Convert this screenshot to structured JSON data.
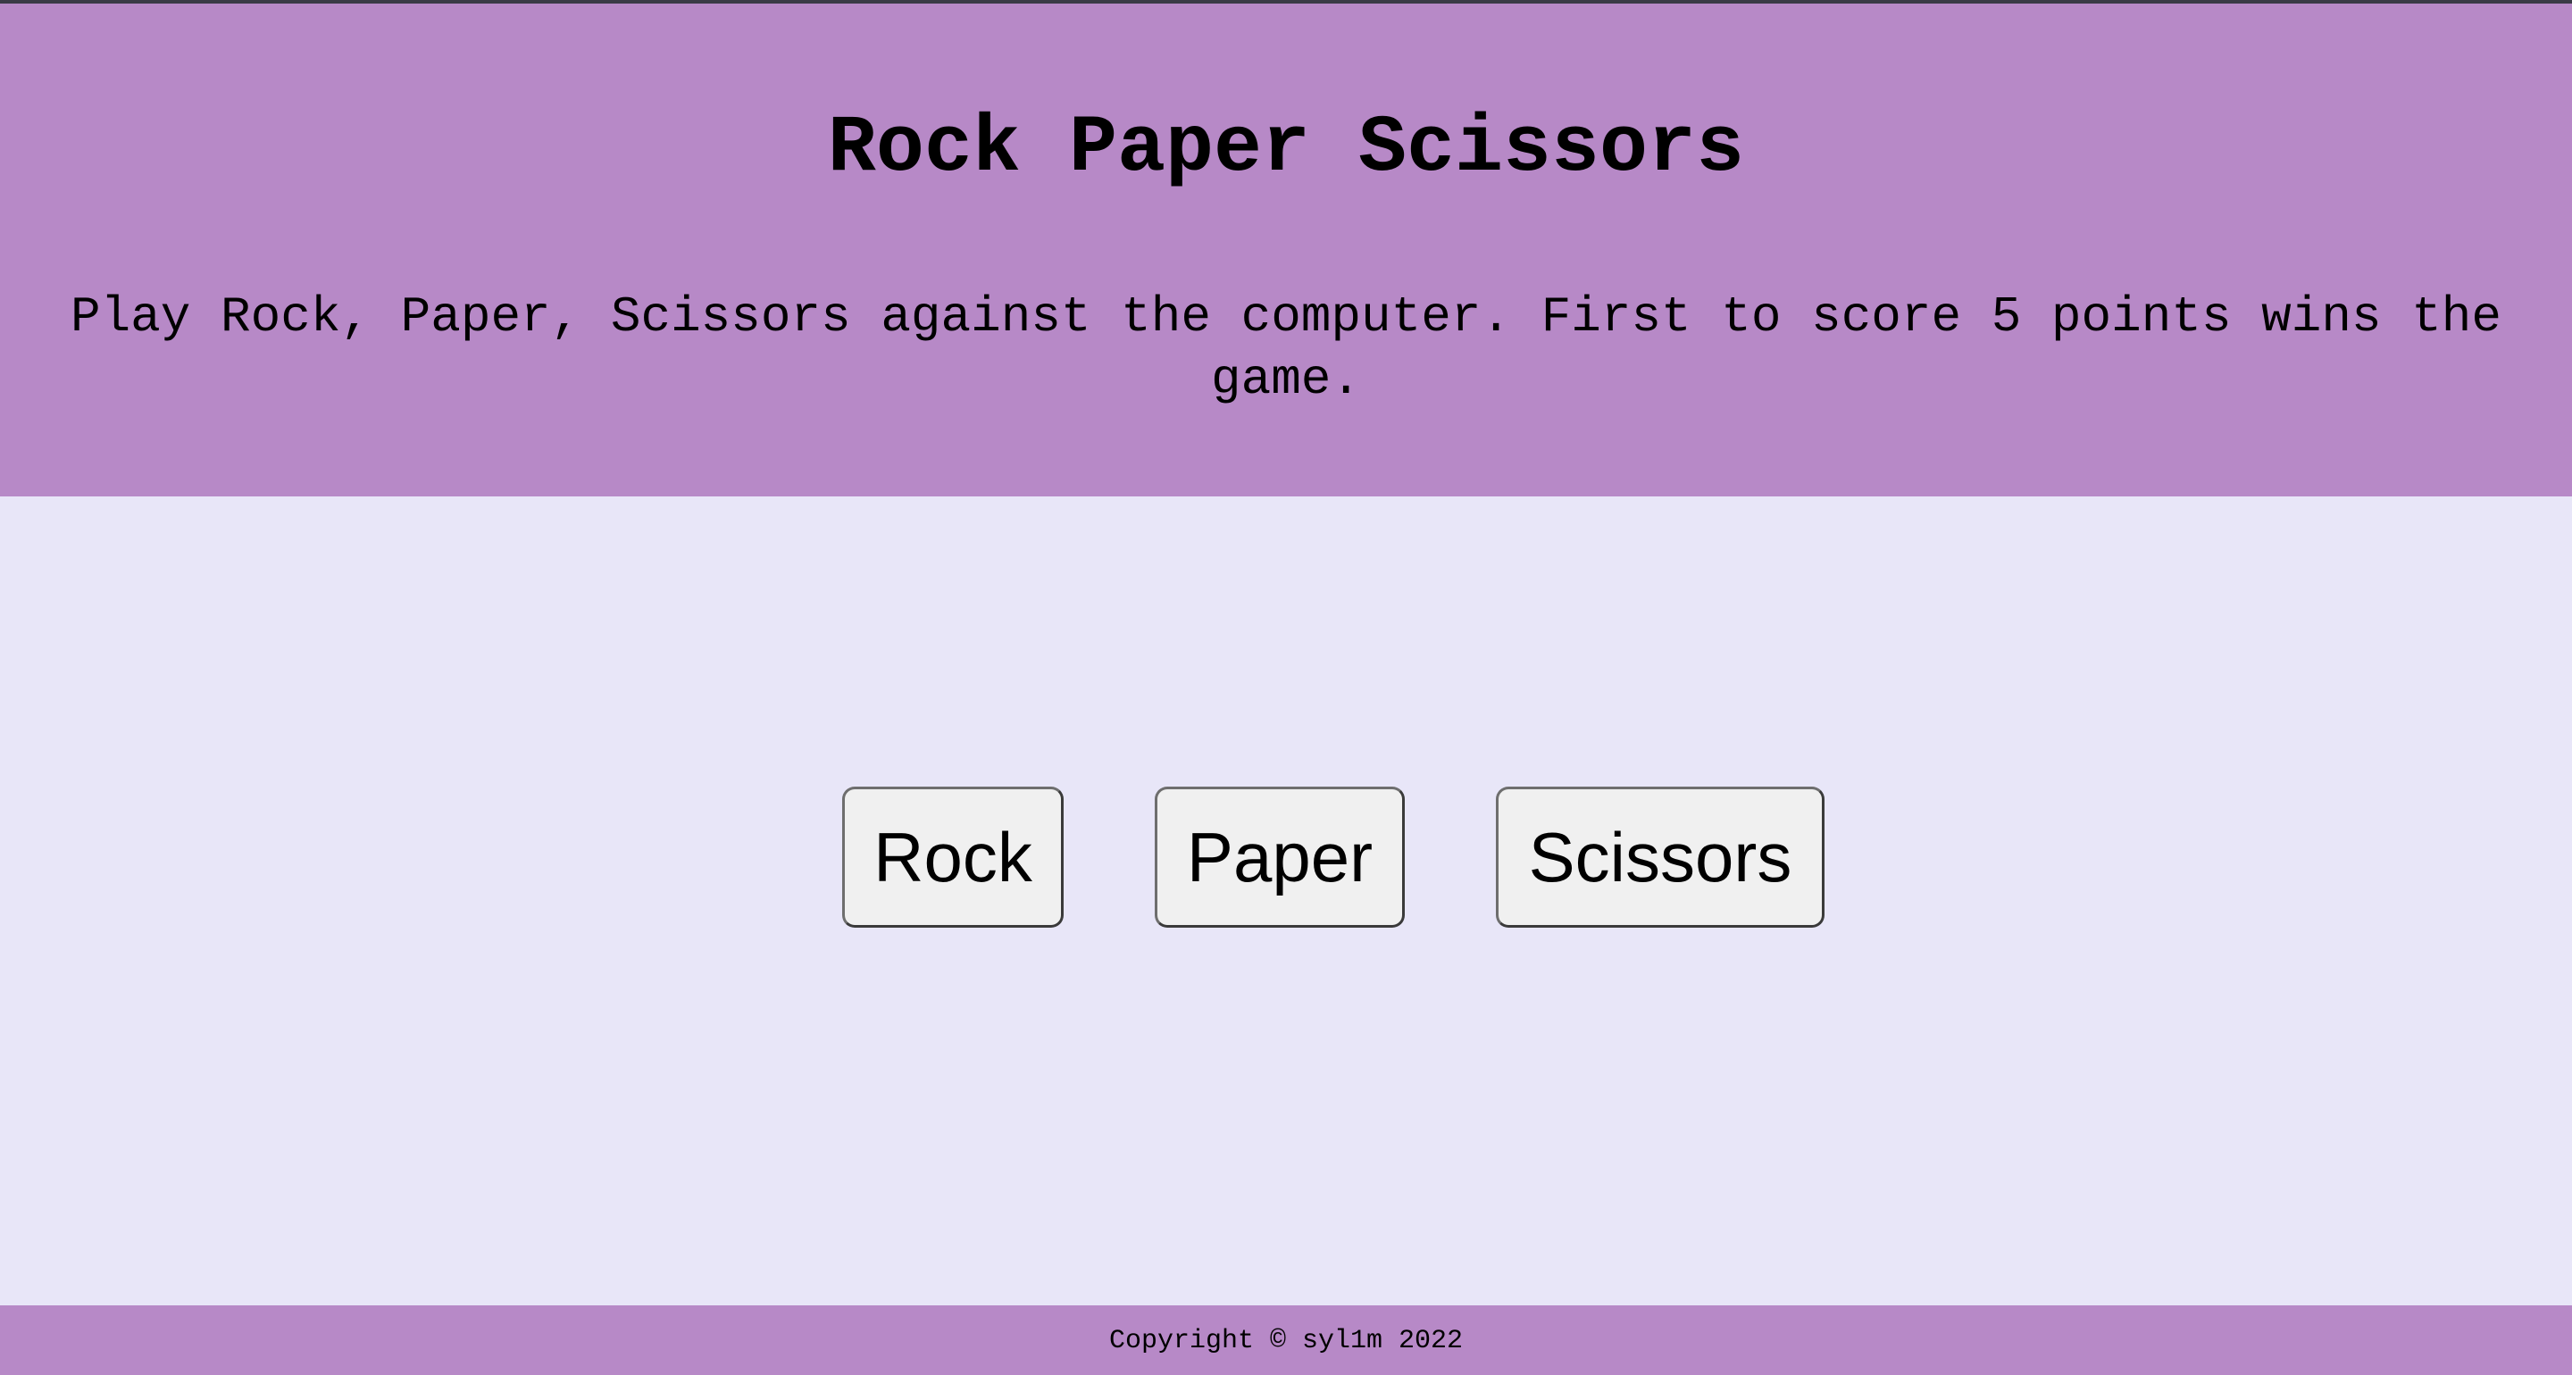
{
  "header": {
    "title": "Rock Paper Scissors",
    "subtitle": "Play Rock, Paper, Scissors against the computer. First to score 5 points wins the game."
  },
  "choices": {
    "rock_label": "Rock",
    "paper_label": "Paper",
    "scissors_label": "Scissors"
  },
  "footer": {
    "copyright": "Copyright © syl1m 2022"
  },
  "colors": {
    "header_background": "#b789c7",
    "page_background": "#e8e6f8",
    "footer_background": "#b789c7",
    "button_background": "#f0f0f0"
  }
}
